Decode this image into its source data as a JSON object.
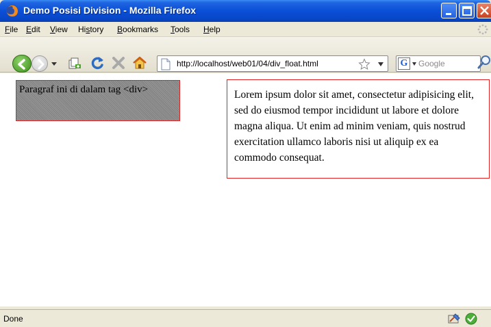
{
  "window": {
    "title": "Demo Posisi Division - Mozilla Firefox"
  },
  "menubar": {
    "items": [
      {
        "label": "File",
        "accesskey": "F"
      },
      {
        "label": "Edit",
        "accesskey": "E"
      },
      {
        "label": "View",
        "accesskey": "V"
      },
      {
        "label": "History",
        "accesskey": "s"
      },
      {
        "label": "Bookmarks",
        "accesskey": "B"
      },
      {
        "label": "Tools",
        "accesskey": "T"
      },
      {
        "label": "Help",
        "accesskey": "H"
      }
    ]
  },
  "toolbar": {
    "url": "http://localhost/web01/04/div_float.html",
    "search_placeholder": "Google"
  },
  "content": {
    "left_box_text": "Paragraf ini di dalam tag <div>",
    "right_box_text": "Lorem ipsum dolor sit amet, consectetur adipisicing elit, sed do eiusmod tempor incididunt ut labore et dolore magna aliqua. Ut enim ad minim veniam, quis nostrud exercitation ullamco laboris nisi ut aliquip ex ea commodo consequat.",
    "box_border_color": "#e02222",
    "left_box_bg_color": "#8a8a8a"
  },
  "statusbar": {
    "text": "Done"
  },
  "colors": {
    "titlebar": "#0a4fd8",
    "chrome": "#ece9d8"
  }
}
